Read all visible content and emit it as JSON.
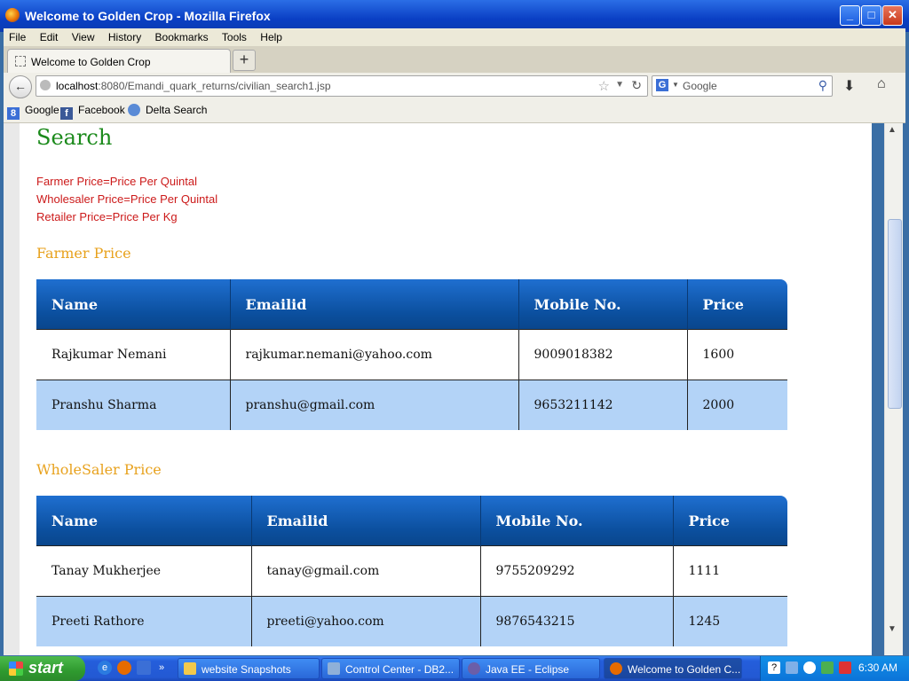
{
  "window": {
    "title": "Welcome to Golden Crop - Mozilla Firefox",
    "minimize": "_",
    "maximize": "□",
    "close": "✕"
  },
  "menu": [
    "File",
    "Edit",
    "View",
    "History",
    "Bookmarks",
    "Tools",
    "Help"
  ],
  "tab": {
    "label": "Welcome to Golden Crop",
    "new_tab": "+"
  },
  "nav": {
    "url_host": "localhost",
    "url_path": ":8080/Emandi_quark_returns/civilian_search1.jsp",
    "search_engine": "G",
    "search_placeholder": "Google"
  },
  "bookmarks": [
    {
      "label": "Google",
      "icon": "google-icon",
      "color": "#3b6fd6",
      "glyph": "8"
    },
    {
      "label": "Facebook",
      "icon": "facebook-icon",
      "color": "#3b5998",
      "glyph": "f"
    },
    {
      "label": "Delta Search",
      "icon": "magnifier-icon",
      "color": "#5a8bd6",
      "glyph": "🔍"
    }
  ],
  "page": {
    "heading": "Search",
    "notes": [
      "Farmer Price=Price Per Quintal",
      "Wholesaler Price=Price Per Quintal",
      "Retailer Price=Price Per Kg"
    ],
    "farmer": {
      "title": "Farmer Price",
      "headers": [
        "Name",
        "Emailid",
        "Mobile No.",
        "Price"
      ],
      "rows": [
        [
          "Rajkumar Nemani",
          "rajkumar.nemani@yahoo.com",
          "9009018382",
          "1600"
        ],
        [
          "Pranshu Sharma",
          "pranshu@gmail.com",
          "9653211142",
          "2000"
        ]
      ]
    },
    "wholesaler": {
      "title": "WholeSaler Price",
      "headers": [
        "Name",
        "Emailid",
        "Mobile No.",
        "Price"
      ],
      "rows": [
        [
          "Tanay Mukherjee",
          "tanay@gmail.com",
          "9755209292",
          "1111"
        ],
        [
          "Preeti Rathore",
          "preeti@yahoo.com",
          "9876543215",
          "1245"
        ]
      ]
    }
  },
  "taskbar": {
    "start": "start",
    "tasks": [
      {
        "label": "website Snapshots",
        "icon": "folder-icon",
        "color": "#f2c94c"
      },
      {
        "label": "Control Center - DB2...",
        "icon": "db2-icon",
        "color": "#8fb0d8"
      },
      {
        "label": "Java EE - Eclipse",
        "icon": "eclipse-icon",
        "color": "#6b5ea8"
      },
      {
        "label": "Welcome to Golden C...",
        "icon": "firefox-icon",
        "color": "#e66b00"
      }
    ],
    "clock": "6:30 AM"
  },
  "colors": {
    "heading": "#1b8a1b",
    "note": "#cc1a1a",
    "section": "#e8a21e",
    "table_header": "#0b4f9e",
    "table_alt_row": "#b3d3f7"
  }
}
